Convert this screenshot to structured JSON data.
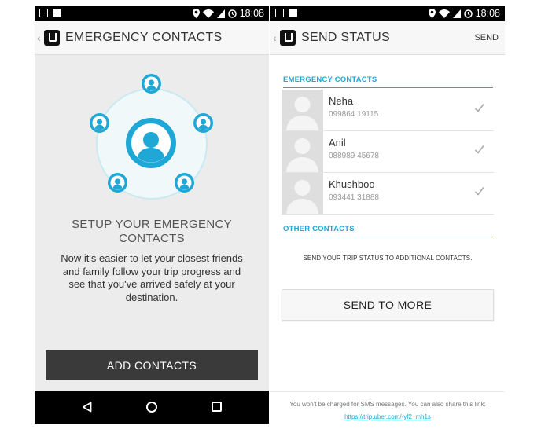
{
  "status_bar": {
    "time": "18:08"
  },
  "left_screen": {
    "title": "EMERGENCY CONTACTS",
    "setup_title_line1": "SETUP YOUR EMERGENCY",
    "setup_title_line2": "CONTACTS",
    "description": "Now it's easier to let your closest friends and family follow your trip progress and see that you've arrived safely at your destination.",
    "add_button": "ADD CONTACTS"
  },
  "right_screen": {
    "title": "SEND STATUS",
    "send_action": "SEND",
    "emergency_header": "EMERGENCY CONTACTS",
    "contacts": [
      {
        "name": "Neha",
        "phone": "099864 19115",
        "checked": true
      },
      {
        "name": "Anil",
        "phone": "088989 45678",
        "checked": true
      },
      {
        "name": "Khushboo",
        "phone": "093441 31888",
        "checked": true
      }
    ],
    "other_header": "OTHER CONTACTS",
    "other_note": "SEND YOUR TRIP STATUS TO ADDITIONAL CONTACTS.",
    "send_more_button": "SEND TO MORE",
    "footer_text": "You won't be charged for SMS messages. You can also share this link:",
    "footer_link": "https://trip.uber.com/-yf2_mh1s"
  },
  "colors": {
    "accent": "#1fa7d6",
    "dark_button": "#3a3a3a"
  },
  "icons": [
    "back-chevron-icon",
    "uber-logo-icon",
    "location-icon",
    "wifi-icon",
    "signal-icon",
    "alarm-icon",
    "person-icon",
    "check-icon",
    "nav-back-icon",
    "nav-home-icon",
    "nav-recents-icon"
  ]
}
